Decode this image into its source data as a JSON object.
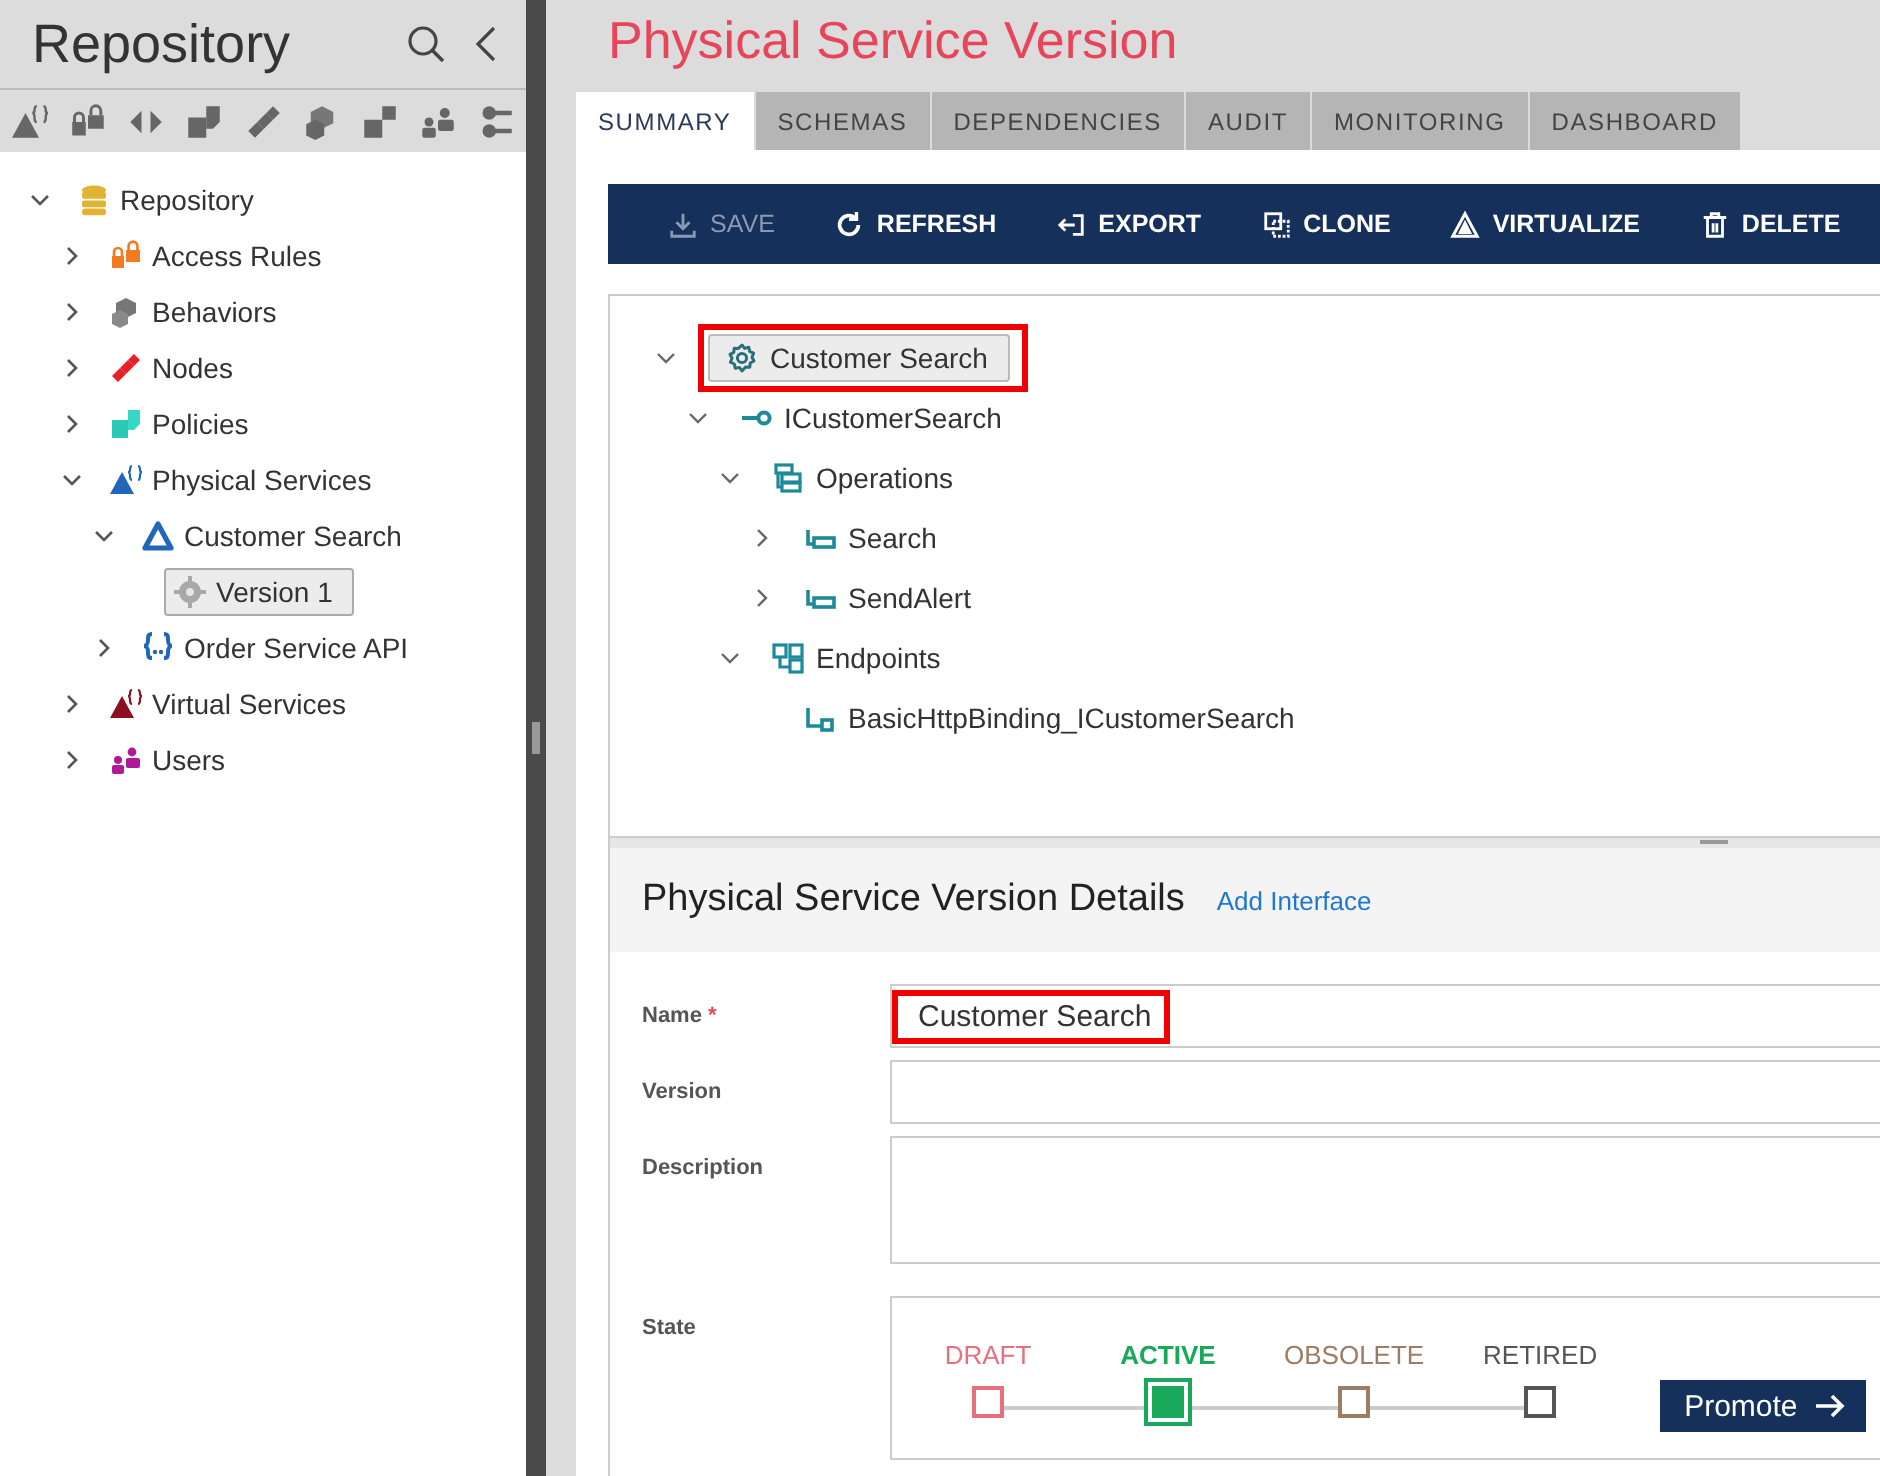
{
  "sidebar": {
    "title": "Repository",
    "tree": [
      {
        "label": "Repository",
        "kind": "database",
        "expanded": true,
        "selected": false,
        "children": [
          {
            "label": "Access Rules",
            "kind": "lock",
            "expanded": false,
            "selected": false
          },
          {
            "label": "Behaviors",
            "kind": "behavior",
            "expanded": false,
            "selected": false
          },
          {
            "label": "Nodes",
            "kind": "node",
            "expanded": false,
            "selected": false
          },
          {
            "label": "Policies",
            "kind": "policy",
            "expanded": false,
            "selected": false
          },
          {
            "label": "Physical Services",
            "kind": "physical",
            "expanded": true,
            "selected": false,
            "children": [
              {
                "label": "Customer Search",
                "kind": "triangle",
                "expanded": true,
                "selected": false,
                "children": [
                  {
                    "label": "Version 1",
                    "kind": "gear",
                    "selected": true
                  }
                ]
              },
              {
                "label": "Order Service API",
                "kind": "braces",
                "expanded": false,
                "selected": false
              }
            ]
          },
          {
            "label": "Virtual Services",
            "kind": "virtual",
            "expanded": false,
            "selected": false
          },
          {
            "label": "Users",
            "kind": "users",
            "expanded": false,
            "selected": false
          }
        ]
      }
    ]
  },
  "page_title": "Physical Service Version",
  "tabs": [
    {
      "label": "SUMMARY",
      "selected": true
    },
    {
      "label": "SCHEMAS",
      "selected": false
    },
    {
      "label": "DEPENDENCIES",
      "selected": false
    },
    {
      "label": "AUDIT",
      "selected": false
    },
    {
      "label": "MONITORING",
      "selected": false
    },
    {
      "label": "DASHBOARD",
      "selected": false
    }
  ],
  "toolbar": [
    {
      "label": "SAVE",
      "kind": "save",
      "disabled": true
    },
    {
      "label": "REFRESH",
      "kind": "refresh",
      "disabled": false
    },
    {
      "label": "EXPORT",
      "kind": "export",
      "disabled": false
    },
    {
      "label": "CLONE",
      "kind": "clone",
      "disabled": false
    },
    {
      "label": "VIRTUALIZE",
      "kind": "virtualize",
      "disabled": false
    },
    {
      "label": "DELETE",
      "kind": "delete",
      "disabled": false
    }
  ],
  "service_tree": [
    {
      "label": "Customer Search",
      "kind": "service",
      "expanded": true,
      "highlighted": true,
      "children": [
        {
          "label": "ICustomerSearch",
          "kind": "interface",
          "expanded": true,
          "highlighted": false,
          "children": [
            {
              "label": "Operations",
              "kind": "operations",
              "expanded": true,
              "highlighted": false,
              "children": [
                {
                  "label": "Search",
                  "kind": "operation",
                  "expanded": false,
                  "highlighted": false
                },
                {
                  "label": "SendAlert",
                  "kind": "operation",
                  "expanded": false,
                  "highlighted": false
                }
              ]
            },
            {
              "label": "Endpoints",
              "kind": "endpoints",
              "expanded": true,
              "highlighted": false,
              "children": [
                {
                  "label": "BasicHttpBinding_ICustomerSearch",
                  "kind": "endpoint",
                  "highlighted": false
                }
              ]
            }
          ]
        }
      ]
    }
  ],
  "details": {
    "title": "Physical Service Version Details",
    "link": "Add Interface",
    "fields": [
      {
        "label": "Name",
        "required_mark": "*",
        "kind": "text",
        "value": "Customer Search",
        "highlighted": true
      },
      {
        "label": "Version",
        "kind": "text",
        "highlighted": false
      },
      {
        "label": "Description",
        "kind": "textarea",
        "highlighted": false
      }
    ],
    "state": {
      "label": "State",
      "steps": [
        {
          "label": "DRAFT",
          "color": "#e8707c",
          "selected": false
        },
        {
          "label": "ACTIVE",
          "color": "#1aa85a",
          "selected": true
        },
        {
          "label": "OBSOLETE",
          "color": "#9a7d62",
          "selected": false
        },
        {
          "label": "RETIRED",
          "color": "#555555",
          "selected": false
        }
      ],
      "button": "Promote"
    }
  }
}
